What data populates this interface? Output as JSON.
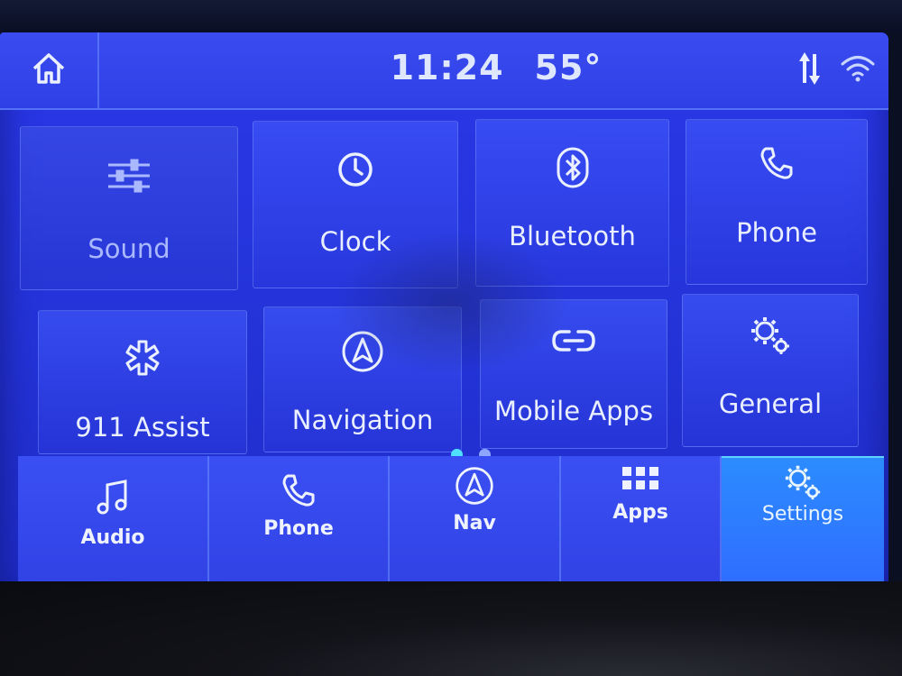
{
  "status": {
    "time": "11:24",
    "temperature": "55°"
  },
  "icons": {
    "home": "home-icon",
    "data": "data-arrows-icon",
    "wifi": "wifi-icon"
  },
  "tiles": [
    {
      "label": "Sound",
      "icon": "sliders-icon"
    },
    {
      "label": "Clock",
      "icon": "clock-icon"
    },
    {
      "label": "Bluetooth",
      "icon": "bluetooth-icon"
    },
    {
      "label": "Phone",
      "icon": "phone-icon"
    },
    {
      "label": "911 Assist",
      "icon": "asterisk-icon"
    },
    {
      "label": "Navigation",
      "icon": "navigation-icon"
    },
    {
      "label": "Mobile Apps",
      "icon": "link-icon"
    },
    {
      "label": "General",
      "icon": "gears-icon"
    }
  ],
  "pager": {
    "pages": 2,
    "current": 1
  },
  "dock": [
    {
      "label": "Audio",
      "icon": "music-note-icon"
    },
    {
      "label": "Phone",
      "icon": "phone-icon"
    },
    {
      "label": "Nav",
      "icon": "navigation-icon"
    },
    {
      "label": "Apps",
      "icon": "grid-icon"
    },
    {
      "label": "Settings",
      "icon": "gears-icon",
      "selected": true
    }
  ],
  "colors": {
    "screen": "#2a36e8",
    "accent": "#4fe0ff",
    "text": "#e9efff"
  }
}
